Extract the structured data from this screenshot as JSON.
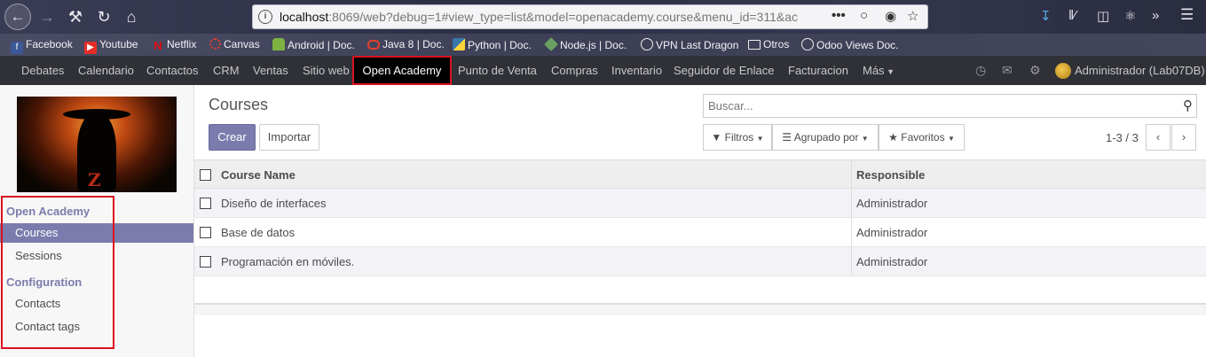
{
  "browser": {
    "url_host": "localhost",
    "url_rest": ":8069/web?debug=1#view_type=list&model=openacademy.course&menu_id=311&ac",
    "bookmarks": [
      "Facebook",
      "Youtube",
      "Netflix",
      "Canvas",
      "Android | Doc.",
      "Java 8 | Doc.",
      "Python | Doc.",
      "Node.js |  Doc.",
      "VPN Last Dragon",
      "Otros",
      "Odoo Views Doc."
    ]
  },
  "topnav": {
    "items": [
      "Debates",
      "Calendario",
      "Contactos",
      "CRM",
      "Ventas",
      "Sitio web"
    ],
    "active": "Open Academy",
    "items_after": [
      "Punto de Venta",
      "Compras",
      "Inventario",
      "Seguidor de Enlace",
      "Facturacion"
    ],
    "more": "Más",
    "user": "Administrador (Lab07DB)"
  },
  "sidebar": {
    "section1": "Open Academy",
    "section1_items": [
      "Courses",
      "Sessions"
    ],
    "section2": "Configuration",
    "section2_items": [
      "Contacts",
      "Contact tags"
    ]
  },
  "main": {
    "title": "Courses",
    "search_placeholder": "Buscar...",
    "create_label": "Crear",
    "import_label": "Importar",
    "filters_label": "Filtros",
    "groupby_label": "Agrupado por",
    "favorites_label": "Favoritos",
    "pager": "1-3 / 3"
  },
  "table": {
    "columns": [
      "Course Name",
      "Responsible"
    ],
    "rows": [
      [
        "Diseño de interfaces",
        "Administrador"
      ],
      [
        "Base de datos",
        "Administrador"
      ],
      [
        "Programación en móviles.",
        "Administrador"
      ]
    ]
  }
}
